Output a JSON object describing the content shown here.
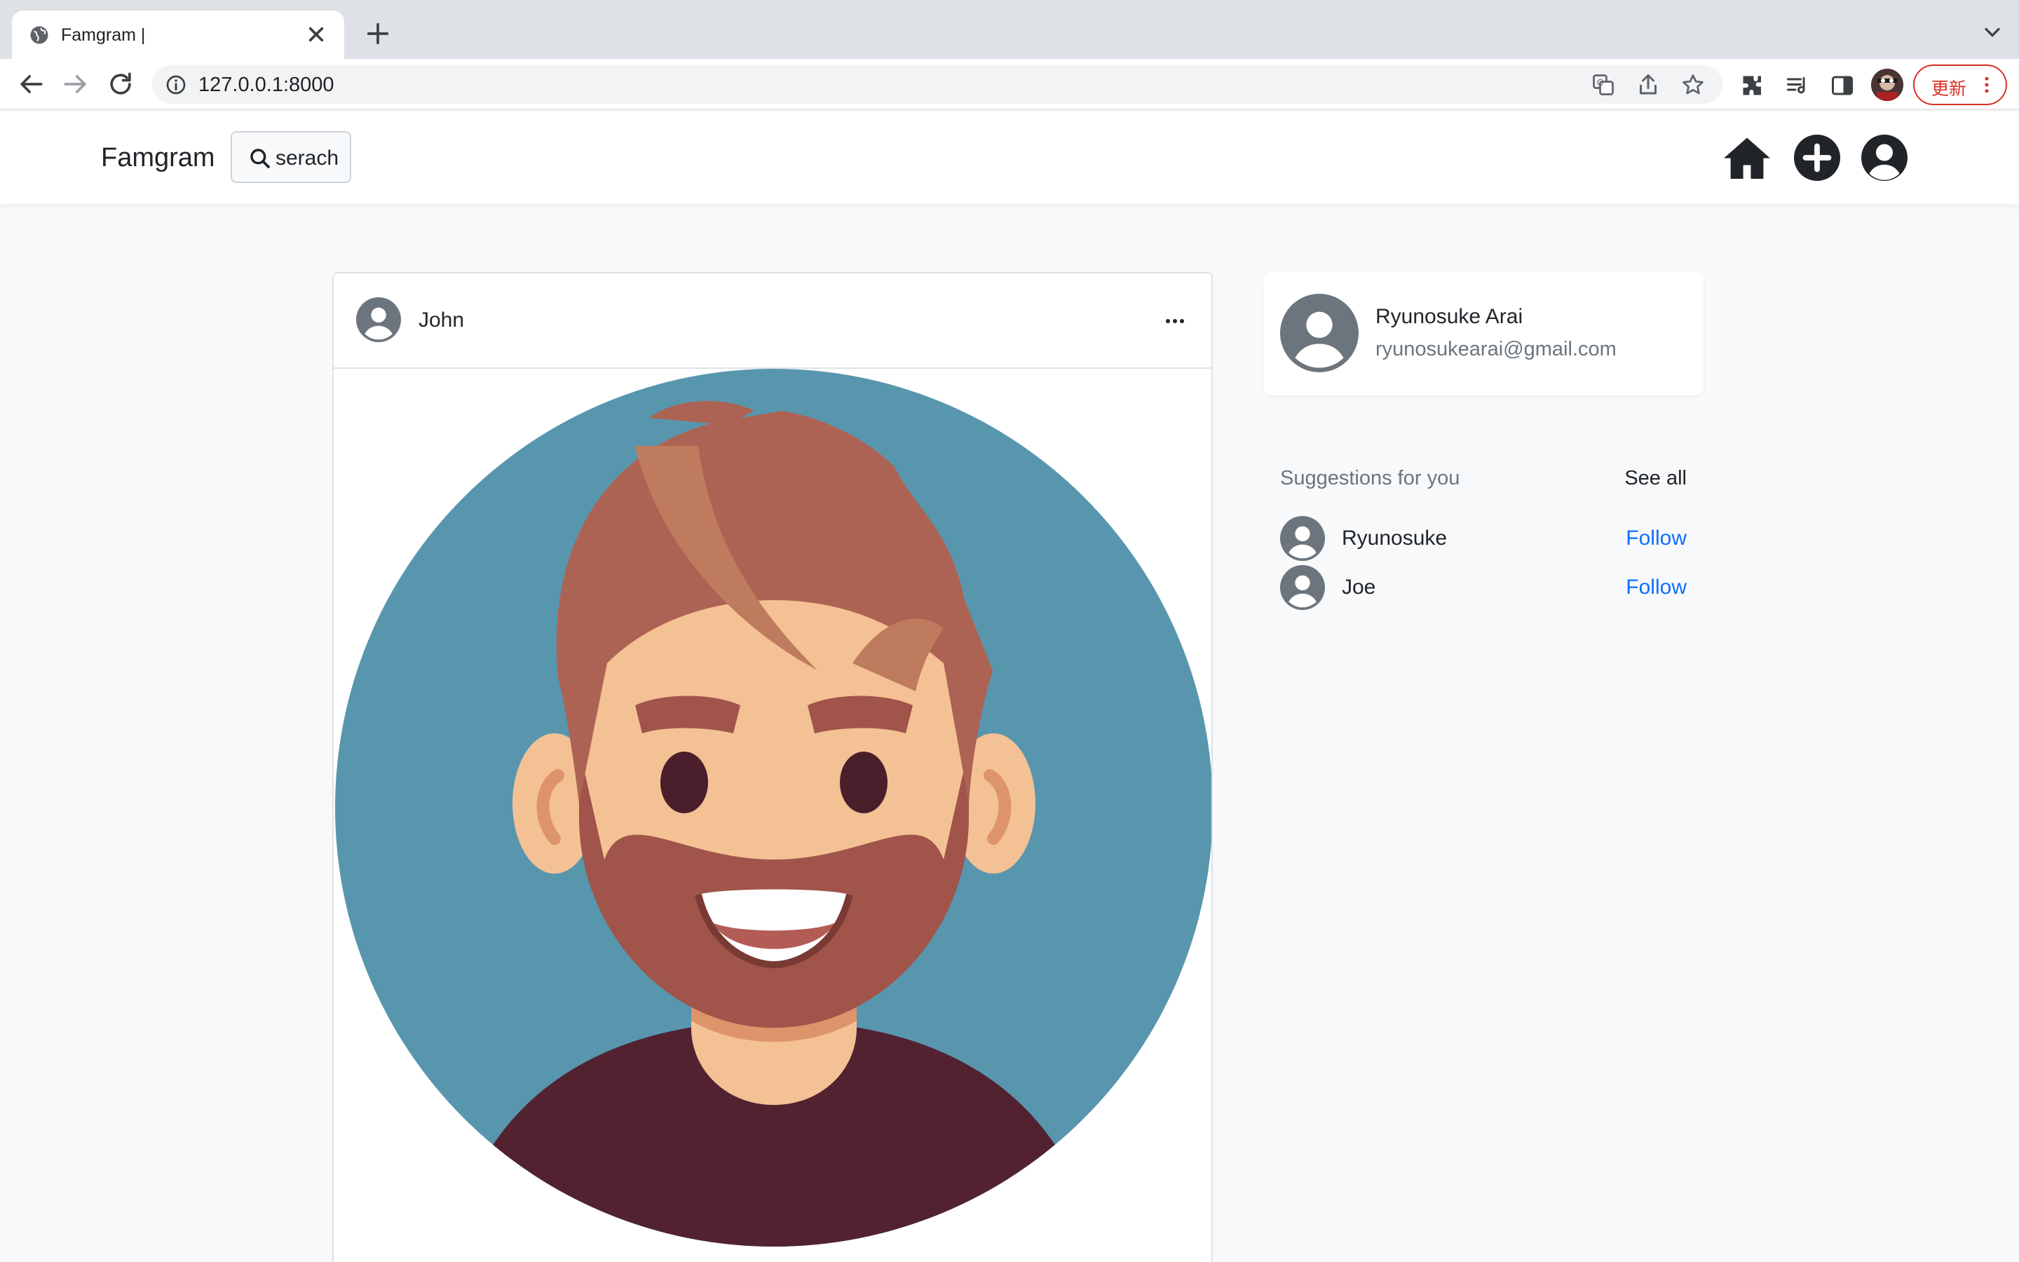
{
  "browser": {
    "tab_title": "Famgram |",
    "url": "127.0.0.1:8000",
    "update_label": "更新"
  },
  "navbar": {
    "brand": "Famgram",
    "search_label": "serach",
    "icons": [
      "home-icon",
      "plus-circle-icon",
      "user-circle-icon"
    ]
  },
  "post": {
    "author": "John",
    "menu_icon": "ellipsis-icon",
    "image_alt_icon": "bearded-man-avatar"
  },
  "me": {
    "name": "Ryunosuke Arai",
    "email": "ryunosukearai@gmail.com"
  },
  "suggestions": {
    "title": "Suggestions for you",
    "see_all": "See all",
    "items": [
      {
        "name": "Ryunosuke",
        "action": "Follow"
      },
      {
        "name": "Joe",
        "action": "Follow"
      }
    ]
  },
  "colors": {
    "link": "#0d6efd",
    "muted": "#6c757d",
    "avatar_gray": "#6c757d",
    "post_bg_circle": "#5896ae"
  }
}
